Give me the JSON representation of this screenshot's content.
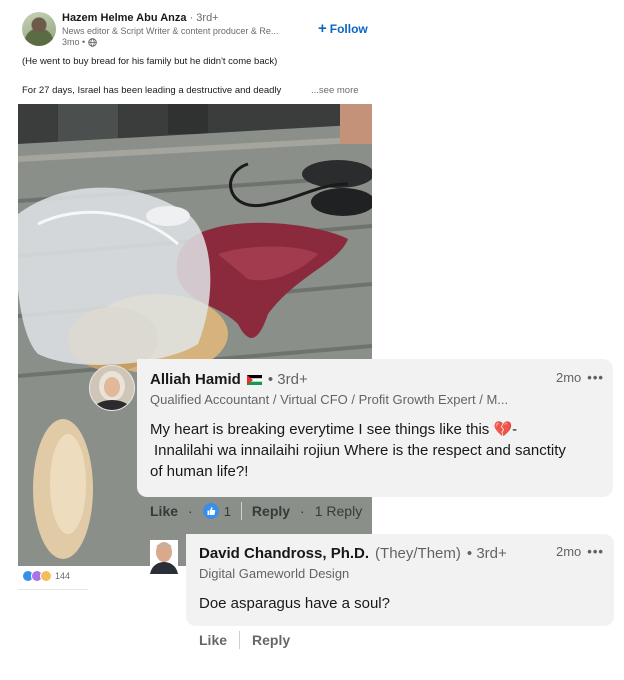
{
  "post": {
    "author": "Hazem Helme Abu Anza",
    "degree": "· 3rd+",
    "headline": "News editor & Script Writer & content producer & Re...",
    "time": "3mo •",
    "follow_label": "Follow",
    "line1": "(He went to buy bread for his family but he didn't come back)",
    "line2": "For 27 days, Israel has been leading a destructive and deadly",
    "see_more": "...see more",
    "reaction_count": "144"
  },
  "comments": [
    {
      "name": "Alliah Hamid",
      "degree": "• 3rd+",
      "headline": "Qualified Accountant / Virtual CFO / Profit Growth Expert / M...",
      "time": "2mo",
      "text_line1": "My heart is breaking everytime I see things like this 💔-",
      "text_line2": "Innalilahi wa innailaihi rojiun Where is the respect and sanctity",
      "text_line3": "of human life?!",
      "like_label": "Like",
      "like_count": "1",
      "reply_label": "Reply",
      "replies_label": "1 Reply"
    },
    {
      "name": "David Chandross, Ph.D.",
      "pronouns": "(They/Them)",
      "degree": "• 3rd+",
      "headline": "Digital Gameworld Design",
      "time": "2mo",
      "text": "Doe asparagus have a soul?",
      "like_label": "Like",
      "reply_label": "Reply"
    }
  ],
  "icons": {
    "globe": "globe-icon",
    "plus": "plus-icon",
    "more": "more-icon",
    "flag": "flag-icon",
    "like_reaction": "like-reaction-icon",
    "heart_reaction": "heart-reaction-icon",
    "support_reaction": "support-reaction-icon"
  },
  "colors": {
    "accent": "#0a66c2",
    "bubble": "#f2f2f2",
    "like_blue": "#378fe9",
    "heart_red": "#df704d",
    "support_purple": "#a872e8"
  }
}
